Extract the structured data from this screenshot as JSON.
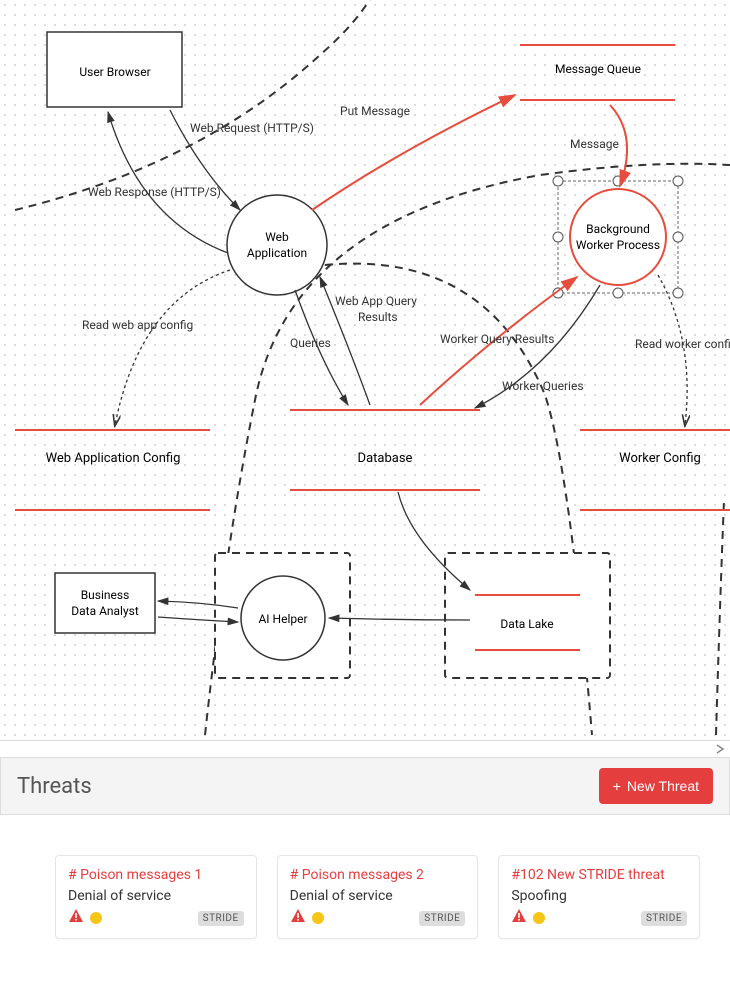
{
  "diagram": {
    "nodes": {
      "user_browser": "User Browser",
      "web_app_line1": "Web",
      "web_app_line2": "Application",
      "bg_worker_line1": "Background",
      "bg_worker_line2": "Worker Process",
      "msg_queue": "Message Queue",
      "web_app_config": "Web Application Config",
      "database": "Database",
      "worker_config": "Worker Config",
      "biz_line1": "Business",
      "biz_line2": "Data Analyst",
      "ai_helper": "AI Helper",
      "data_lake": "Data Lake"
    },
    "edges": {
      "web_request": "Web Request (HTTP/S)",
      "web_response": "Web Response (HTTP/S)",
      "put_message": "Put Message",
      "message": "Message",
      "read_web_cfg": "Read web app config",
      "queries": "Queries",
      "web_app_qr_line1": "Web App Query",
      "web_app_qr_line2": "Results",
      "worker_qr": "Worker Query Results",
      "worker_queries": "Worker Queries",
      "read_worker_cfg": "Read worker config"
    }
  },
  "threats": {
    "title": "Threats",
    "new_btn": "New Threat",
    "cards": [
      {
        "title": "# Poison messages 1",
        "sub": "Denial of service",
        "badge": "STRIDE"
      },
      {
        "title": "# Poison messages 2",
        "sub": "Denial of service",
        "badge": "STRIDE"
      },
      {
        "title": "#102 New STRIDE threat",
        "sub": "Spoofing",
        "badge": "STRIDE"
      }
    ]
  }
}
